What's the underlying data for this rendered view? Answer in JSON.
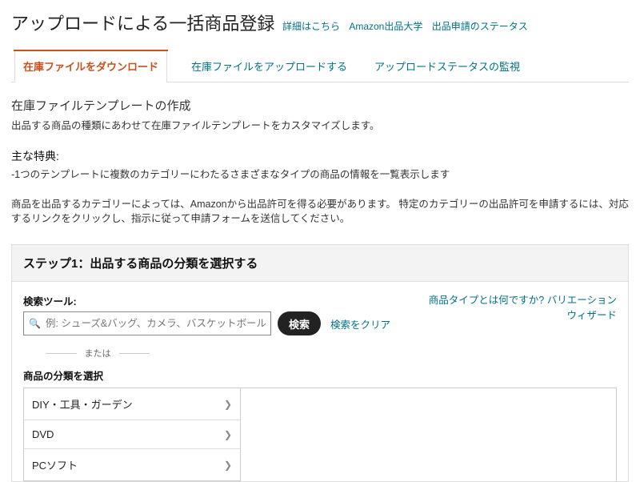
{
  "header": {
    "title": "アップロードによる一括商品登録",
    "links": [
      "詳細はこちら",
      "Amazon出品大学",
      "出品申請のステータス"
    ]
  },
  "tabs": [
    {
      "label": "在庫ファイルをダウンロード",
      "active": true
    },
    {
      "label": "在庫ファイルをアップロードする",
      "active": false
    },
    {
      "label": "アップロードステータスの監視",
      "active": false
    }
  ],
  "template_section": {
    "heading": "在庫ファイルテンプレートの作成",
    "desc": "出品する商品の種類にあわせて在庫ファイルテンプレートをカスタマイズします。"
  },
  "benefits": {
    "heading": "主な特典:",
    "item": "-1つのテンプレートに複数のカテゴリーにわたるさまざまなタイプの商品の情報を一覧表示します"
  },
  "notice": "商品を出品するカテゴリーによっては、Amazonから出品許可を得る必要があります。 特定のカテゴリーの出品許可を申請するには、対応するリンクをクリックし、指示に従って申請フォームを送信してください。",
  "step1": {
    "title": "ステップ1：出品する商品の分類を選択する",
    "search_label": "検索ツール:",
    "search_placeholder": "例: シューズ&バッグ、カメラ、バスケットボールなど",
    "search_button": "検索",
    "clear": "検索をクリア",
    "right_link_a": "商品タイプとは何ですか?",
    "right_link_b": "バリエーションウィザード",
    "or": "または",
    "select_label": "商品の分類を選択",
    "categories": [
      "DIY・工具・ガーデン",
      "DVD",
      "PCソフト"
    ]
  }
}
